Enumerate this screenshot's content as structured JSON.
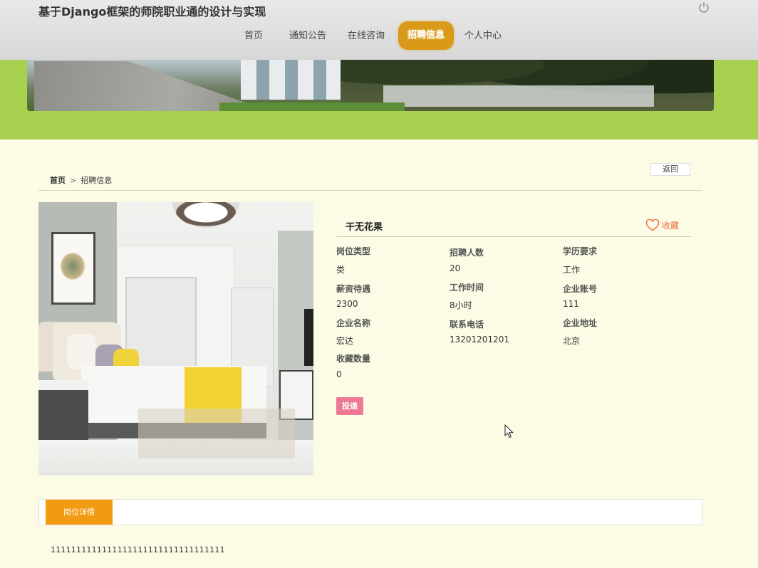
{
  "header": {
    "site_title": "基于Django框架的师院职业通的设计与实现",
    "nav": [
      "首页",
      "通知公告",
      "在线咨询",
      "招聘信息",
      "个人中心"
    ],
    "active_nav": "招聘信息"
  },
  "breadcrumb": {
    "home": "首页",
    "separator": ">",
    "current": "招聘信息"
  },
  "back_label": "返回",
  "job": {
    "title": "干无花果",
    "favorite_label": "收藏",
    "fields": [
      {
        "label": "岗位类型",
        "value": "类"
      },
      {
        "label": "招聘人数",
        "value": "20"
      },
      {
        "label": "学历要求",
        "value": "工作"
      },
      {
        "label": "薪资待遇",
        "value": "2300"
      },
      {
        "label": "工作时间",
        "value": "8小时"
      },
      {
        "label": "企业账号",
        "value": "111"
      },
      {
        "label": "企业名称",
        "value": "宏达"
      },
      {
        "label": "联系电话",
        "value": "13201201201"
      },
      {
        "label": "企业地址",
        "value": "北京"
      },
      {
        "label": "收藏数量",
        "value": "0"
      }
    ],
    "apply_label": "投递"
  },
  "tabs": {
    "active": "岗位详情"
  },
  "detail_content": "1111111111111111111111111111111111",
  "colors": {
    "accent": "#f29a12",
    "nav_active": "#d99a1a",
    "green_band": "#a8d14f",
    "apply": "#ec7a95",
    "favorite": "#ec6b3b",
    "background": "#fbfbe6"
  },
  "icons": {
    "power": "power-icon",
    "favorite": "heart-outline-icon",
    "cursor": "mouse-pointer-icon"
  }
}
